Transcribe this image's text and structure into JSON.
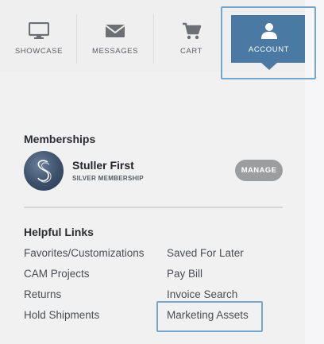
{
  "nav": {
    "items": [
      {
        "label": "SHOWCASE",
        "icon": "monitor-icon"
      },
      {
        "label": "MESSAGES",
        "icon": "envelope-icon"
      },
      {
        "label": "CART",
        "icon": "cart-icon"
      },
      {
        "label": "ACCOUNT",
        "icon": "user-icon",
        "active": true
      }
    ]
  },
  "memberships": {
    "title": "Memberships",
    "name": "Stuller First",
    "level": "SILVER MEMBERSHIP",
    "manage_label": "MANAGE"
  },
  "helpful_links": {
    "title": "Helpful Links",
    "left": [
      "Favorites/Customizations",
      "CAM Projects",
      "Returns",
      "Hold Shipments"
    ],
    "right": [
      "Saved For Later",
      "Pay Bill",
      "Invoice Search",
      "Marketing Assets"
    ]
  },
  "colors": {
    "accent": "#4a7aa3",
    "focus_outline": "#76a6cc",
    "manage_button": "#9b9d9f"
  }
}
